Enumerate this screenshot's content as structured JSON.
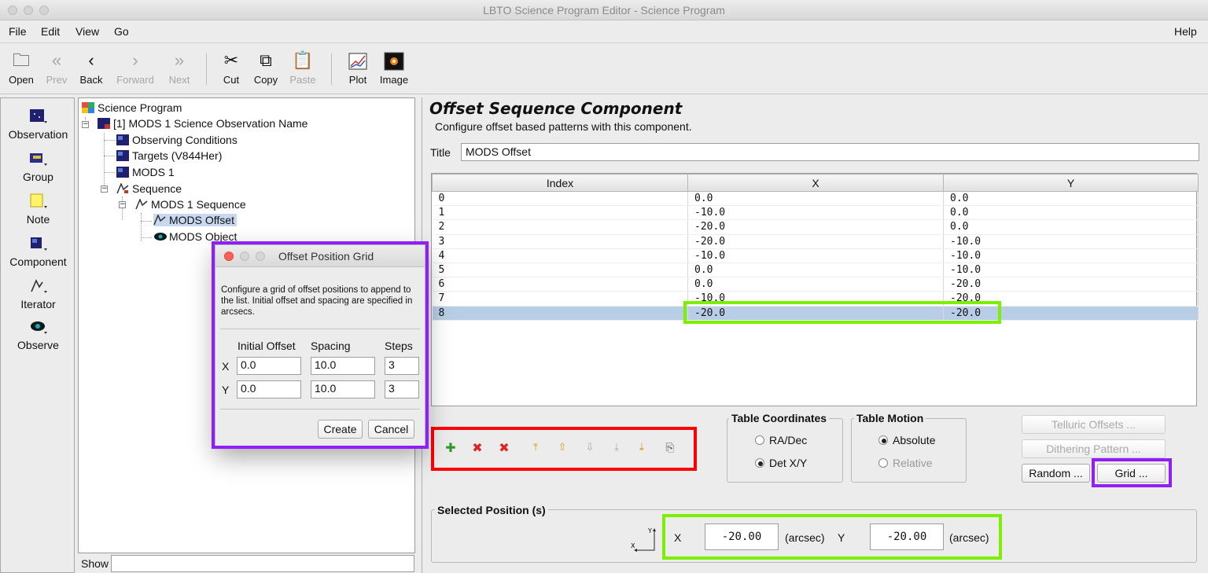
{
  "window": {
    "title": "LBTO Science Program Editor - Science Program"
  },
  "menubar": {
    "file": "File",
    "edit": "Edit",
    "view": "View",
    "go": "Go",
    "help": "Help"
  },
  "toolbar": {
    "open": "Open",
    "prev": "Prev",
    "back": "Back",
    "forward": "Forward",
    "next": "Next",
    "cut": "Cut",
    "copy": "Copy",
    "paste": "Paste",
    "plot": "Plot",
    "image": "Image"
  },
  "palette": {
    "observation": "Observation",
    "group": "Group",
    "note": "Note",
    "component": "Component",
    "iterator": "Iterator",
    "observe": "Observe"
  },
  "tree": {
    "root": "Science Program",
    "observation": "[1] MODS 1 Science Observation Name",
    "conditions": "Observing Conditions",
    "targets": "Targets (V844Her)",
    "mods1": "MODS 1",
    "sequence": "Sequence",
    "mods1_sequence": "MODS 1 Sequence",
    "mods_offset": "MODS Offset",
    "mods_object": "MODS Object"
  },
  "show_label": "Show",
  "component": {
    "title": "Offset Sequence Component",
    "description": "Configure offset based patterns with this component.",
    "title_label": "Title",
    "title_value": "MODS Offset"
  },
  "table": {
    "headers": [
      "Index",
      "X",
      "Y"
    ],
    "rows": [
      [
        "0",
        "0.0",
        "0.0"
      ],
      [
        "1",
        "-10.0",
        "0.0"
      ],
      [
        "2",
        "-20.0",
        "0.0"
      ],
      [
        "3",
        "-20.0",
        "-10.0"
      ],
      [
        "4",
        "-10.0",
        "-10.0"
      ],
      [
        "5",
        "0.0",
        "-10.0"
      ],
      [
        "6",
        "0.0",
        "-20.0"
      ],
      [
        "7",
        "-10.0",
        "-20.0"
      ],
      [
        "8",
        "-20.0",
        "-20.0"
      ]
    ],
    "selected_row": 8
  },
  "table_coordinates": {
    "label": "Table Coordinates",
    "ra_dec": "RA/Dec",
    "det_xy": "Det X/Y",
    "selected": "Det X/Y"
  },
  "table_motion": {
    "label": "Table Motion",
    "absolute": "Absolute",
    "relative": "Relative",
    "selected": "Absolute"
  },
  "buttons": {
    "telluric": "Telluric Offsets ...",
    "dithering": "Dithering Pattern ...",
    "random": "Random ...",
    "grid": "Grid ..."
  },
  "selected_position": {
    "label": "Selected Position (s)",
    "x_label": "X",
    "x_value": "-20.00",
    "unit": "(arcsec)",
    "y_label": "Y",
    "y_value": "-20.00"
  },
  "dialog": {
    "title": "Offset Position Grid",
    "description": "Configure a grid of offset positions to append to the list. Initial offset and spacing are specified in arcsecs.",
    "col_initial": "Initial Offset",
    "col_spacing": "Spacing",
    "col_steps": "Steps",
    "x_label": "X",
    "x_initial": "0.0",
    "x_spacing": "10.0",
    "x_steps": "3",
    "y_label": "Y",
    "y_initial": "0.0",
    "y_spacing": "10.0",
    "y_steps": "3",
    "create": "Create",
    "cancel": "Cancel"
  },
  "colors": {
    "highlight_red": "#ff0000",
    "highlight_green": "#7cf000",
    "highlight_purple": "#8f1ff5",
    "selection": "#b8cde6"
  }
}
